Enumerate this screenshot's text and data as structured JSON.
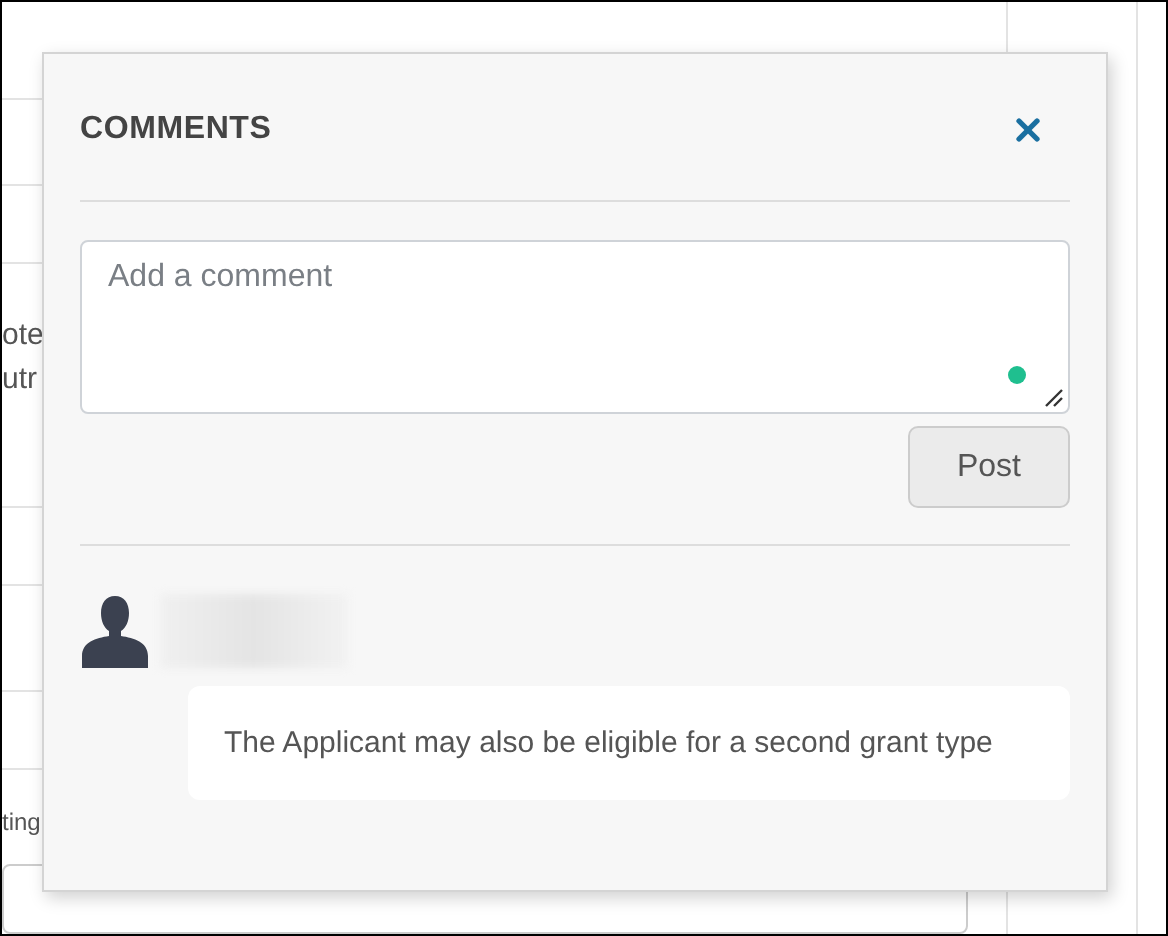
{
  "background": {
    "fragments": [
      "ote",
      "utr",
      "ting"
    ]
  },
  "dialog": {
    "title": "COMMENTS",
    "comment_field": {
      "placeholder": "Add a comment"
    },
    "post_button": "Post",
    "comments": [
      {
        "text": "The Applicant may also be eligible for a second grant type"
      }
    ]
  }
}
